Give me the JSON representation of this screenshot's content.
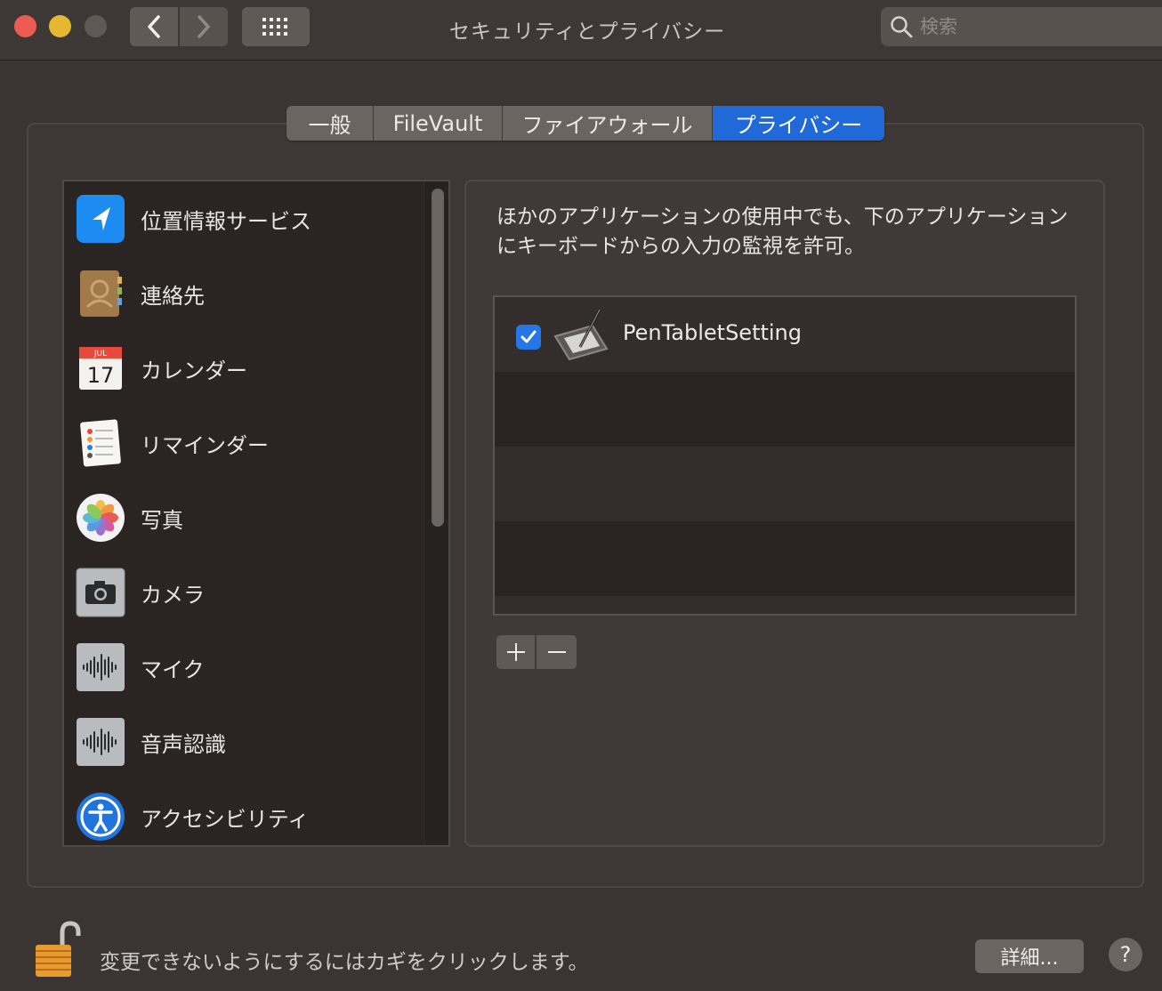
{
  "window": {
    "title": "セキュリティとプライバシー",
    "search_placeholder": "検索"
  },
  "tabs": [
    {
      "label": "一般",
      "active": false
    },
    {
      "label": "FileVault",
      "active": false
    },
    {
      "label": "ファイアウォール",
      "active": false
    },
    {
      "label": "プライバシー",
      "active": true
    }
  ],
  "sidebar": {
    "items": [
      {
        "label": "位置情報サービス",
        "icon": "location-icon"
      },
      {
        "label": "連絡先",
        "icon": "contacts-icon"
      },
      {
        "label": "カレンダー",
        "icon": "calendar-icon",
        "month": "JUL",
        "day": "17"
      },
      {
        "label": "リマインダー",
        "icon": "reminders-icon"
      },
      {
        "label": "写真",
        "icon": "photos-icon"
      },
      {
        "label": "カメラ",
        "icon": "camera-icon"
      },
      {
        "label": "マイク",
        "icon": "microphone-icon"
      },
      {
        "label": "音声認識",
        "icon": "speech-recognition-icon"
      },
      {
        "label": "アクセシビリティ",
        "icon": "accessibility-icon"
      }
    ]
  },
  "main": {
    "description": "ほかのアプリケーションの使用中でも、下のアプリケーションにキーボードからの入力の監視を許可。",
    "apps": [
      {
        "name": "PenTabletSetting",
        "checked": true,
        "icon": "pen-tablet-icon"
      }
    ],
    "add_symbol": "+",
    "remove_symbol": "−"
  },
  "footer": {
    "lock_text": "変更できないようにするにはカギをクリックします。",
    "details_label": "詳細...",
    "help_label": "?"
  },
  "colors": {
    "accent": "#1f6ad8",
    "background": "#3a3532",
    "list_background": "#2a2522"
  }
}
